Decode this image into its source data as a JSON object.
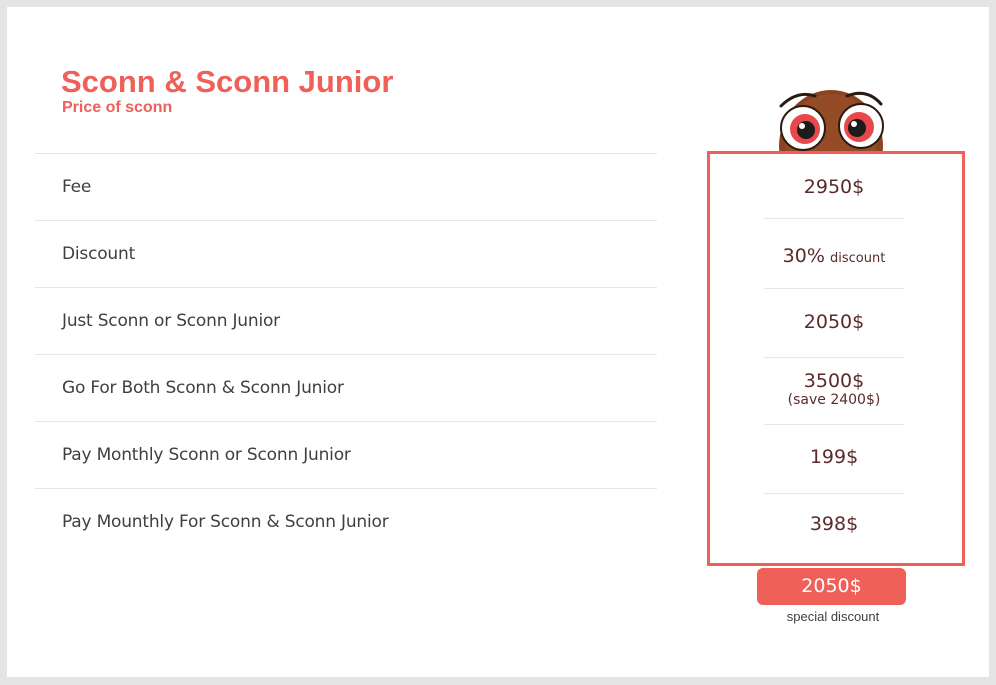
{
  "header": {
    "title": "Sconn & Sconn Junior",
    "subtitle": "Price of sconn"
  },
  "rows": [
    {
      "label": "Fee"
    },
    {
      "label": "Discount"
    },
    {
      "label": "Just Sconn or Sconn Junior"
    },
    {
      "label": "Go For Both Sconn & Sconn Junior"
    },
    {
      "label": "Pay Monthly Sconn or Sconn Junior"
    },
    {
      "label": "Pay Mounthly For Sconn & Sconn Junior"
    }
  ],
  "prices": [
    {
      "main": "2950$"
    },
    {
      "main": "30%",
      "small": "discount"
    },
    {
      "main": "2050$"
    },
    {
      "main": "3500$",
      "note": "(save 2400$)"
    },
    {
      "main": "199$"
    },
    {
      "main": "398$"
    }
  ],
  "special": {
    "button_label": "2050$",
    "caption": "special discount"
  },
  "colors": {
    "accent": "#ef6059",
    "price_text": "#5a2b2b",
    "mascot_body": "#8a4422"
  },
  "icons": {
    "mascot": "owl-mascot-icon"
  }
}
